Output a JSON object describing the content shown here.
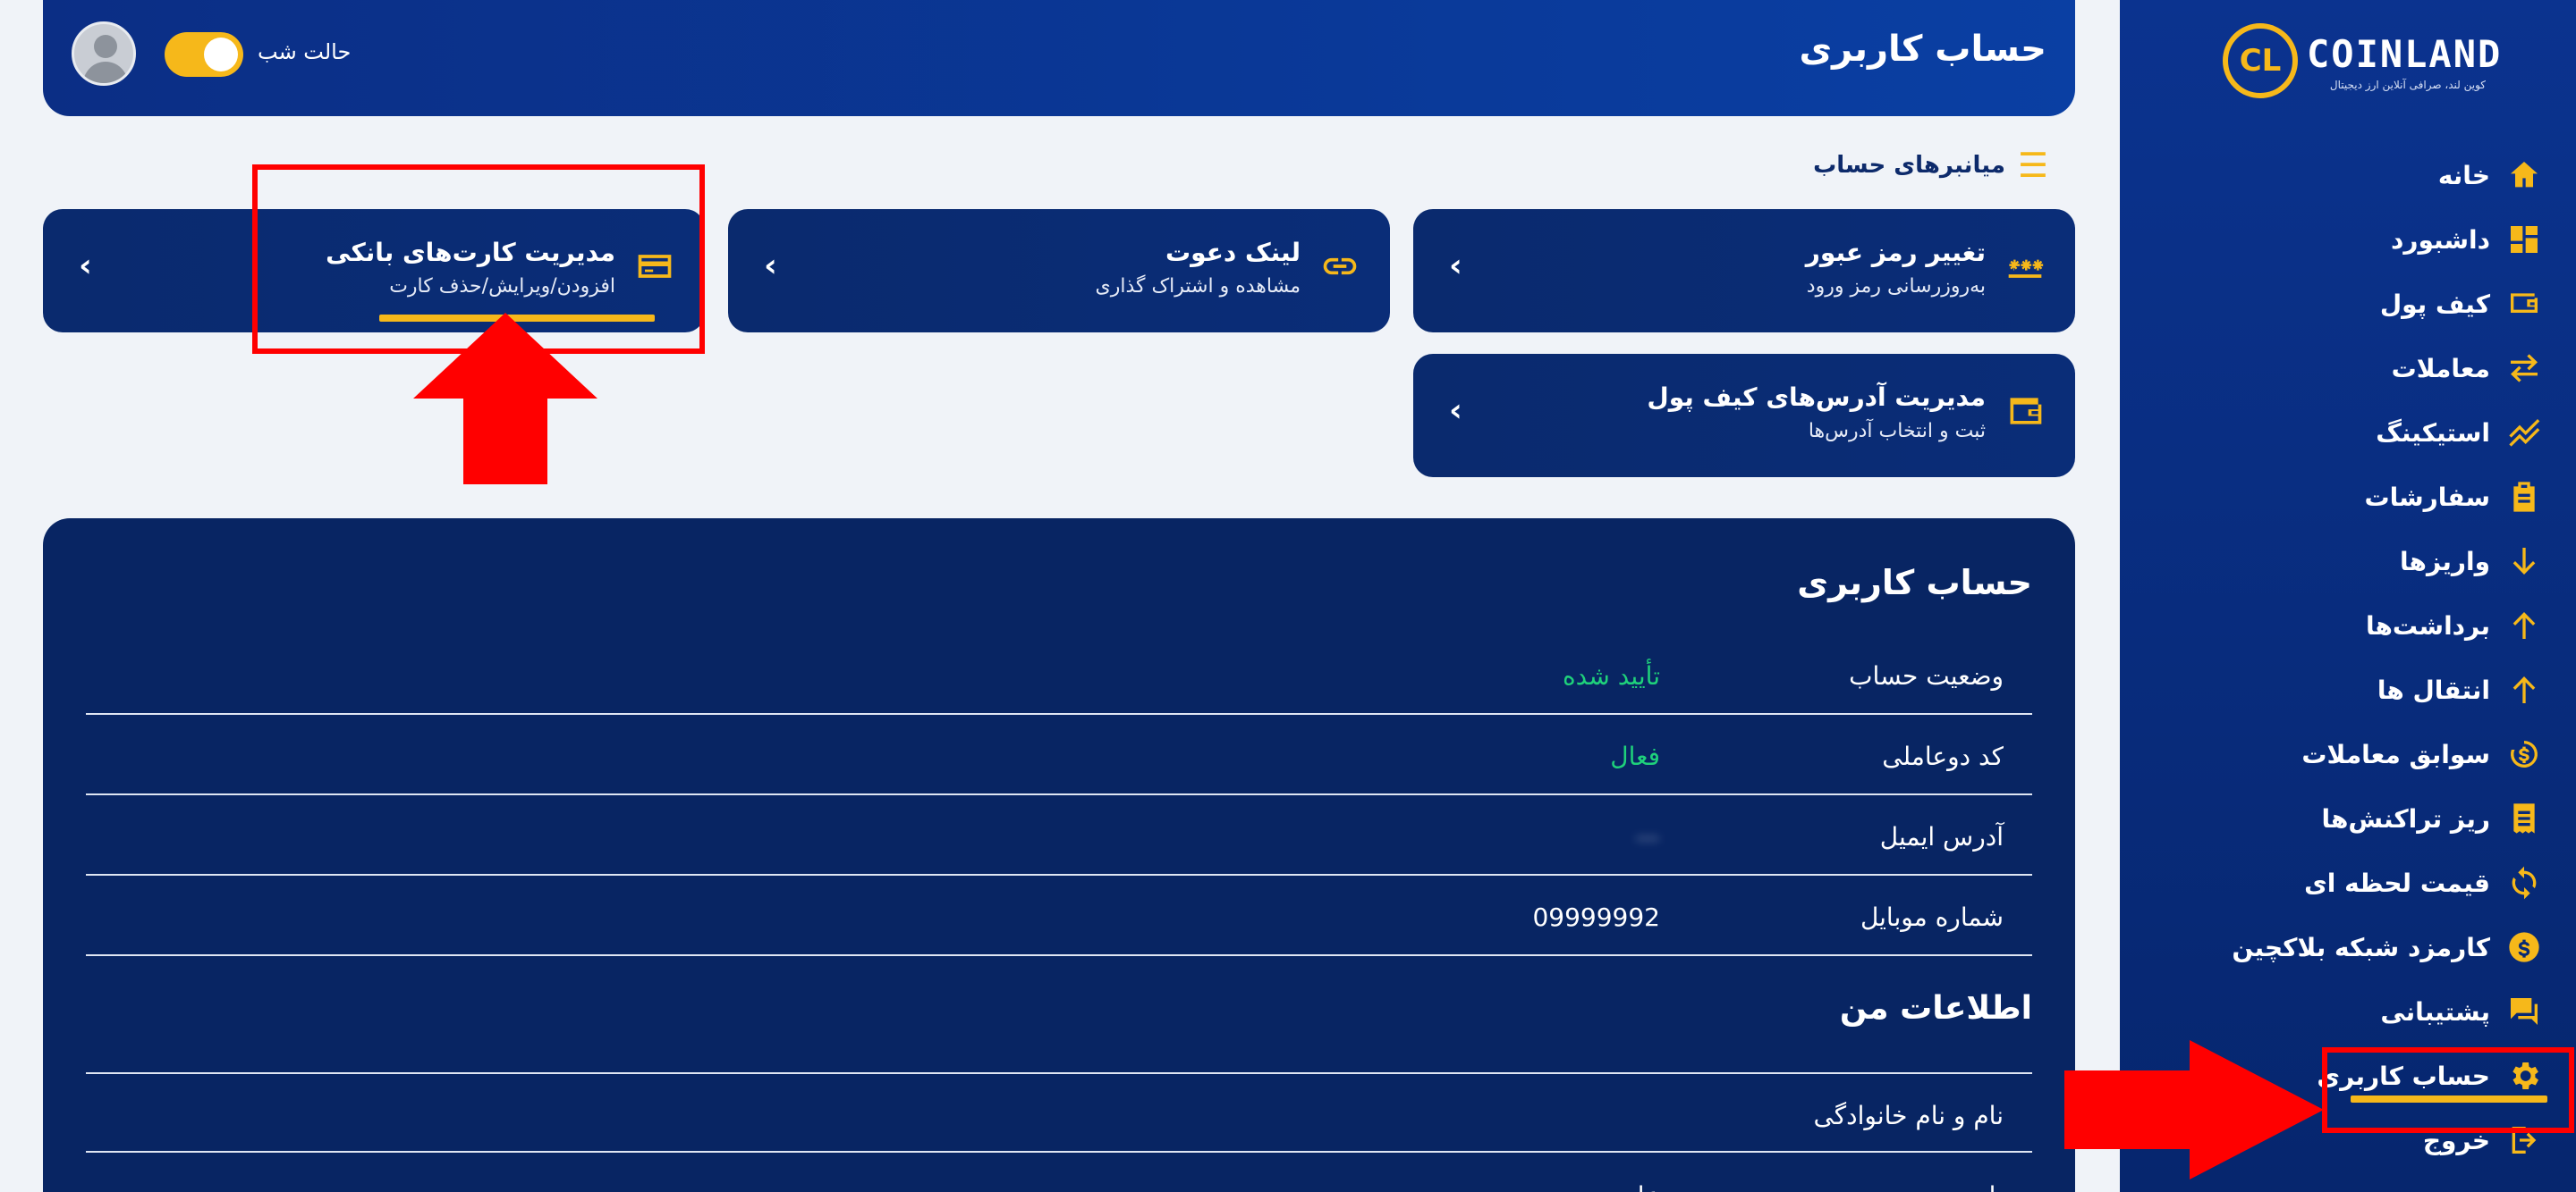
{
  "brand": {
    "name": "COINLAND",
    "tagline": "کوین لند، صرافی آنلاین ارز دیجیتال",
    "accent_color": "#f6b81a",
    "primary_color": "#0a2d78"
  },
  "header": {
    "title": "حساب کاربری",
    "night_mode_label": "حالت شب",
    "night_mode_on": true
  },
  "sidebar": {
    "items": [
      {
        "label": "خانه",
        "icon": "home-icon"
      },
      {
        "label": "داشبورد",
        "icon": "dashboard-icon"
      },
      {
        "label": "کیف پول",
        "icon": "wallet-icon"
      },
      {
        "label": "معاملات",
        "icon": "swap-icon"
      },
      {
        "label": "استیکینگ",
        "icon": "staking-icon"
      },
      {
        "label": "سفارشات",
        "icon": "clipboard-icon"
      },
      {
        "label": "واریزها",
        "icon": "arrow-down-icon"
      },
      {
        "label": "برداشت‌ها",
        "icon": "arrow-up-icon"
      },
      {
        "label": "انتقال ها",
        "icon": "transfer-icon"
      },
      {
        "label": "سوابق معاملات",
        "icon": "history-dollar-icon"
      },
      {
        "label": "ریز تراکنش‌ها",
        "icon": "receipt-icon"
      },
      {
        "label": "قیمت لحظه ای",
        "icon": "refresh-icon"
      },
      {
        "label": "کارمزد شبکه بلاکچین",
        "icon": "dollar-coin-icon"
      },
      {
        "label": "پشتیبانی",
        "icon": "chat-icon"
      },
      {
        "label": "حساب کاربری",
        "icon": "gear-icon"
      },
      {
        "label": "خروج",
        "icon": "logout-icon"
      }
    ]
  },
  "shortcuts": {
    "heading": "میانبرهای حساب",
    "cards": [
      {
        "title": "تغییر رمز عبور",
        "subtitle": "به‌روزرسانی رمز ورود",
        "icon": "password-icon"
      },
      {
        "title": "لینک دعوت",
        "subtitle": "مشاهده و اشتراک گذاری",
        "icon": "link-icon"
      },
      {
        "title": "مدیریت کارت‌های بانکی",
        "subtitle": "افزودن/ویرایش/حذف کارت",
        "icon": "credit-card-icon"
      },
      {
        "title": "مدیریت آدرس‌های کیف پول",
        "subtitle": "ثبت و انتخاب آدرس‌ها",
        "icon": "wallet-icon"
      }
    ]
  },
  "account": {
    "title": "حساب کاربری",
    "rows": [
      {
        "label": "وضعیت حساب",
        "value": "تأیید شده"
      },
      {
        "label": "کد دوعاملی",
        "value": "فعال"
      },
      {
        "label": "آدرس ایمیل",
        "value": "—"
      },
      {
        "label": "شماره موبایل",
        "value": "09999992"
      }
    ]
  },
  "profile": {
    "title": "اطلاعات من",
    "rows": [
      {
        "label": "نام و نام خانوادگی",
        "value": ""
      },
      {
        "label": "نام پدر",
        "value": "علی"
      }
    ]
  }
}
